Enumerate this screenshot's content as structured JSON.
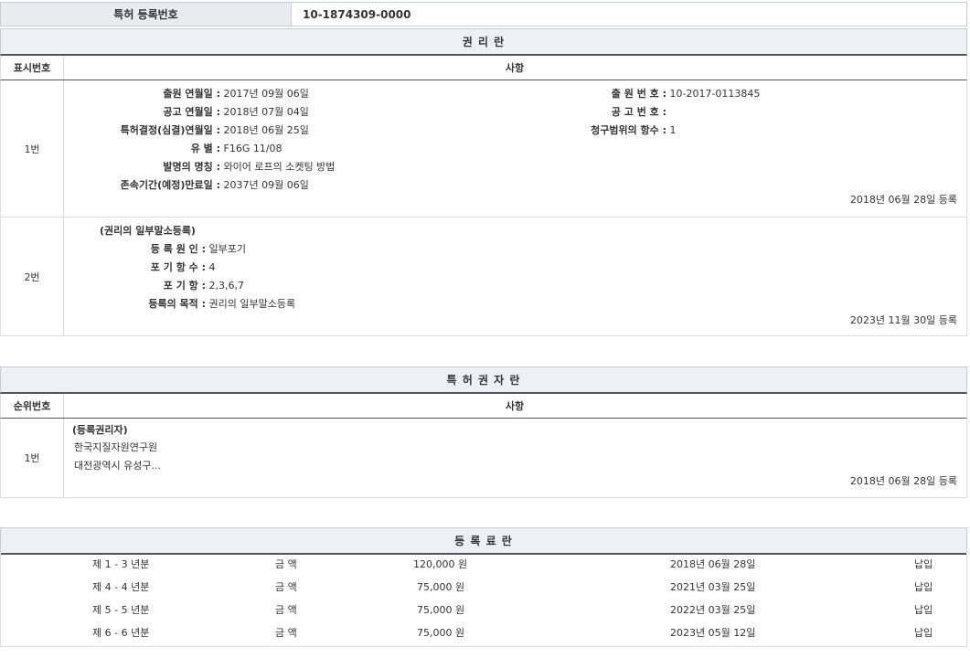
{
  "registration": {
    "label": "특허 등록번호",
    "value": "10-1874309-0000"
  },
  "rights": {
    "title": "권 리 란",
    "col_num": "표시번호",
    "col_desc": "사항",
    "entry1": {
      "num": "1번",
      "app_date_label": "출원 연월일 :",
      "app_date": "2017년 09월 06일",
      "pub_date_label": "공고 연월일 :",
      "pub_date": "2018년 07월 04일",
      "decision_label": "특허결정(심결)연월일 :",
      "decision": "2018년 06월 25일",
      "class_label": "유 별 :",
      "class": "F16G 11/08",
      "invention_label": "발명의 명칭 :",
      "invention": "와이어 로프의 소켓팅 방법",
      "expiry_label": "존속기간(예정)만료일 :",
      "expiry": "2037년 09월 06일",
      "app_no_label": "출 원 번 호 :",
      "app_no": "10-2017-0113845",
      "pub_no_label": "공 고 번 호 :",
      "pub_no": "",
      "claims_label": "청구범위의 항수 :",
      "claims": "1",
      "reg_date": "2018년 06월 28일 등록"
    },
    "entry2": {
      "num": "2번",
      "heading": "(권리의 일부말소등록)",
      "cause_label": "등 록 원 인 :",
      "cause": "일부포기",
      "waived_count_label": "포 기 항 수 :",
      "waived_count": "4",
      "waived_label": "포 기 항 :",
      "waived": "2,3,6,7",
      "purpose_label": "등록의 목적 :",
      "purpose": "권리의 일부말소등록",
      "reg_date": "2023년 11월 30일 등록"
    }
  },
  "holders": {
    "title": "특 허 권 자 란",
    "col_num": "순위번호",
    "col_desc": "사항",
    "entry1": {
      "num": "1번",
      "heading": "(등록권리자)",
      "name": "한국지질자원연구원",
      "address": "대전광역시 유성구...",
      "reg_date": "2018년 06월 28일 등록"
    }
  },
  "fees": {
    "title": "등 록 료 란",
    "rows": [
      {
        "period": "제 1 - 3 년분",
        "amount_label": "금 액",
        "amount": "120,000 원",
        "date": "2018년 06월 28일",
        "status": "납입"
      },
      {
        "period": "제 4 - 4 년분",
        "amount_label": "금 액",
        "amount": "75,000 원",
        "date": "2021년 03월 25일",
        "status": "납입"
      },
      {
        "period": "제 5 - 5 년분",
        "amount_label": "금 액",
        "amount": "75,000 원",
        "date": "2022년 03월 25일",
        "status": "납입"
      },
      {
        "period": "제 6 - 6 년분",
        "amount_label": "금 액",
        "amount": "75,000 원",
        "date": "2023년 05월 12일",
        "status": "납입"
      }
    ]
  }
}
